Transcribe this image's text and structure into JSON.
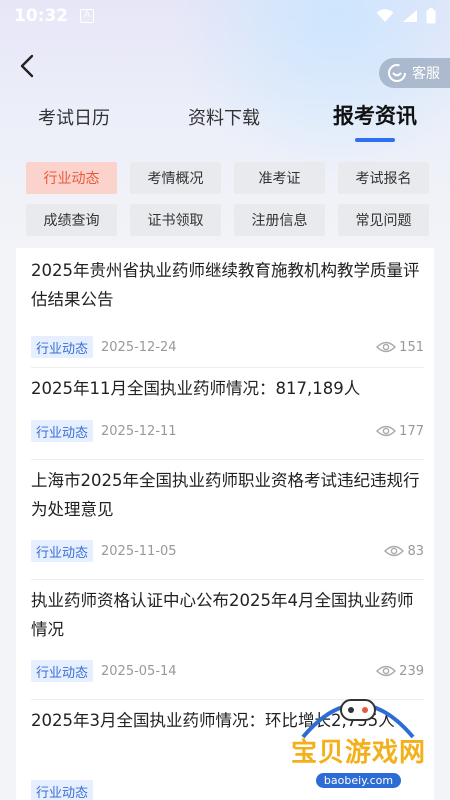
{
  "status": {
    "time": "10:32",
    "notif_glyph": "A"
  },
  "nav": {
    "service_label": "客服"
  },
  "tabs": [
    {
      "label": "考试日历"
    },
    {
      "label": "资料下载"
    },
    {
      "label": "报考资讯"
    }
  ],
  "filters": [
    {
      "label": "行业动态",
      "active": true
    },
    {
      "label": "考情概况"
    },
    {
      "label": "准考证"
    },
    {
      "label": "考试报名"
    },
    {
      "label": "成绩查询"
    },
    {
      "label": "证书领取"
    },
    {
      "label": "注册信息"
    },
    {
      "label": "常见问题"
    }
  ],
  "articles": [
    {
      "title": "2025年贵州省执业药师继续教育施教机构教学质量评估结果公告",
      "tag": "行业动态",
      "date": "2025-12-24",
      "views": "151"
    },
    {
      "title": "2025年11月全国执业药师情况：817,189人",
      "tag": "行业动态",
      "date": "2025-12-11",
      "views": "177"
    },
    {
      "title": "上海市2025年全国执业药师职业资格考试违纪违规行为处理意见",
      "tag": "行业动态",
      "date": "2025-11-05",
      "views": "83"
    },
    {
      "title": "执业药师资格认证中心公布2025年4月全国执业药师情况",
      "tag": "行业动态",
      "date": "2025-05-14",
      "views": "239"
    },
    {
      "title": "2025年3月全国执业药师情况：环比增长2,755人",
      "tag": "行业动态",
      "date": "",
      "views": ""
    }
  ],
  "watermark": {
    "name": "宝贝游戏网",
    "url": "baobeiy.com"
  },
  "colors": {
    "accent": "#2f6ff0",
    "active_chip_bg": "#fbd3cc",
    "active_chip_text": "#e85a3c",
    "tag_bg": "#e6efff",
    "tag_text": "#3a6fd1"
  }
}
